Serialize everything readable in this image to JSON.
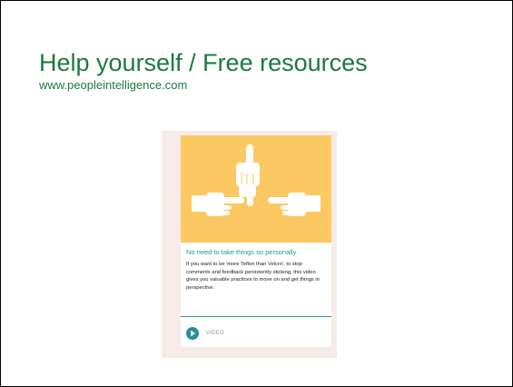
{
  "slide": {
    "title": "Help yourself / Free resources",
    "subtitle": "www.peopleintelligence.com"
  },
  "card": {
    "title": "No need to take things so personally",
    "description": "If you want to be 'more Teflon than Velcro', to stop comments and feedback persistently sticking, this video gives you valuable practices to move on and get things in perspective.",
    "footer_label": "VIDEO",
    "hero_icon": "pointing-hands-icon",
    "play_icon": "play-icon"
  },
  "colors": {
    "title": "#1b7a3e",
    "card_frame": "#f5ebe9",
    "hero_background": "#fcc862",
    "accent_teal": "#1f9a8c",
    "play_button": "#2a8f9c"
  }
}
